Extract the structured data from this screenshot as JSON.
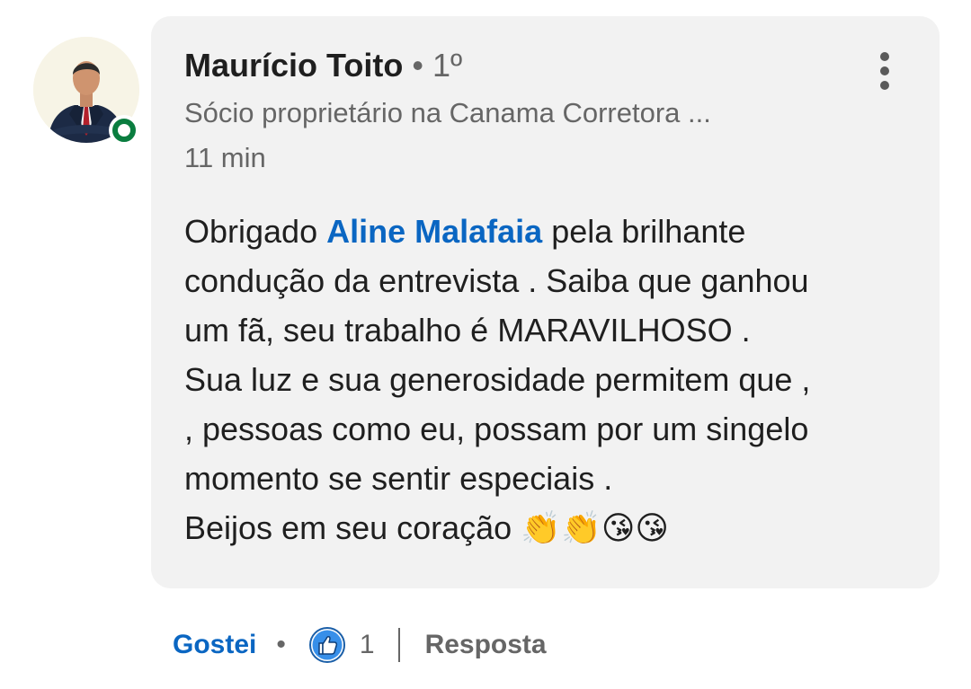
{
  "comment": {
    "author": {
      "name": "Maurício Toito",
      "degree": "• 1º",
      "headline": "Sócio proprietário na Canama Corretora ...",
      "online": true
    },
    "time": "11 min",
    "body": {
      "line1_prefix": "Obrigado ",
      "mention": "Aline Malafaia",
      "line1_suffix": " pela brilhante",
      "line2": "condução da entrevista . Saiba que ganhou",
      "line3": "um fã, seu trabalho é MARAVILHOSO .",
      "line4": "Sua luz e sua generosidade permitem que ,",
      "line5": ", pessoas como eu, possam por um singelo",
      "line6": "momento se sentir especiais .",
      "line7": "Beijos em seu coração 👏👏😘😘"
    }
  },
  "actions": {
    "like_label": "Gostei",
    "separator": "•",
    "reaction_icon": "thumbs-up-icon",
    "reaction_count": "1",
    "reply_label": "Resposta"
  },
  "colors": {
    "bubble_bg": "#f2f2f2",
    "link_blue": "#0a66c2",
    "secondary_text": "#666666",
    "online_green": "#0a7d3f"
  }
}
